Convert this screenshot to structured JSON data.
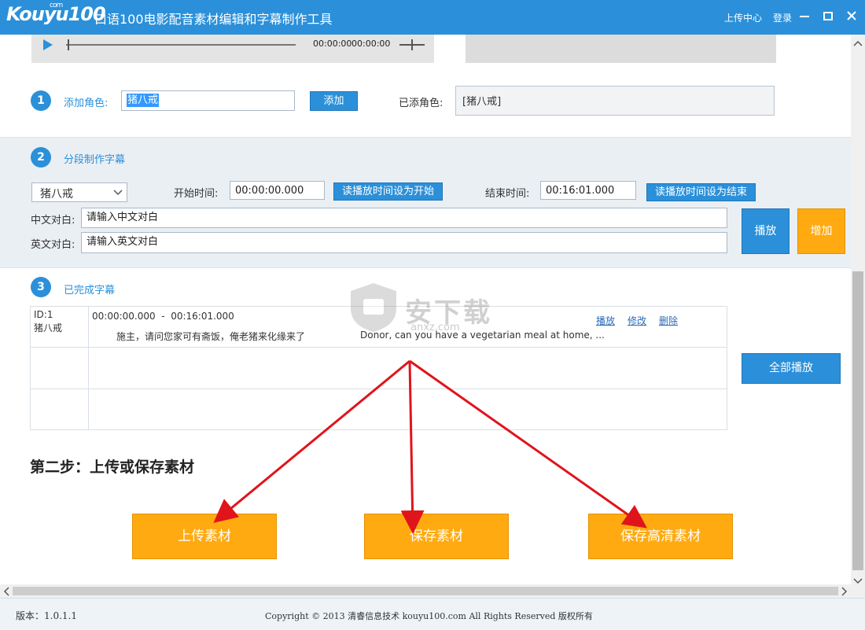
{
  "app": {
    "logo_text": "Kouyu100",
    "logo_com": "com",
    "title": "口语100电影配音素材编辑和字幕制作工具",
    "upload_center": "上传中心",
    "login": "登录"
  },
  "player": {
    "time_current": "00:00:00",
    "time_total": "00:00:00"
  },
  "step1": {
    "number": "1",
    "label": "添加角色:",
    "input_value": "猪八戒",
    "add_button": "添加",
    "added_label": "已添角色:",
    "added_value": "[猪八戒]"
  },
  "step2": {
    "number": "2",
    "label": "分段制作字幕",
    "role_select": "猪八戒",
    "start_label": "开始时间:",
    "start_value": "00:00:00.000",
    "set_start_button": "读播放时间设为开始",
    "end_label": "结束时间:",
    "end_value": "00:16:01.000",
    "set_end_button": "读播放时间设为结束",
    "cn_label": "中文对白:",
    "cn_placeholder": "请输入中文对白",
    "en_label": "英文对白:",
    "en_placeholder": "请输入英文对白",
    "play_button": "播放",
    "add_button": "增加"
  },
  "step3": {
    "number": "3",
    "label": "已完成字幕",
    "rows": [
      {
        "id": "ID:1",
        "role": "猪八戒",
        "time_range": "00:00:00.000  -  00:16:01.000",
        "chinese": "施主，请问您家可有斋饭，俺老猪来化缘来了",
        "english": "Donor, can you have a vegetarian meal at home, ...",
        "play": "播放",
        "edit": "修改",
        "delete": "删除"
      }
    ],
    "play_all_button": "全部播放"
  },
  "step_two": {
    "heading": "第二步：上传或保存素材",
    "upload_button": "上传素材",
    "save_button": "保存素材",
    "save_hd_button": "保存高清素材"
  },
  "watermark": {
    "title": "安下载",
    "subtitle": "anxz.com"
  },
  "status": {
    "version": "版本：1.0.1.1",
    "copyright": "Copyright © 2013 清睿信息技术 kouyu100.com All Rights Reserved 版权所有"
  },
  "colors": {
    "brand_blue": "#2b90d9",
    "orange": "#ffaa10",
    "arrow_red": "#e0141b"
  }
}
